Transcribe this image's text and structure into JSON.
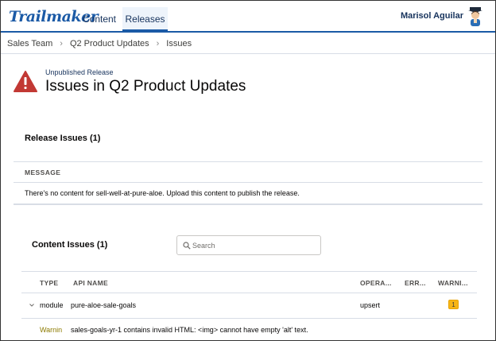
{
  "app": {
    "logo_text": "Trailmaker",
    "brand_color": "#1b5aa6"
  },
  "nav": {
    "tabs": [
      {
        "label": "Content",
        "active": false
      },
      {
        "label": "Releases",
        "active": true
      }
    ],
    "user_name": "Marisol Aguilar",
    "avatar_icon": "avatar-icon"
  },
  "breadcrumb": [
    "Sales Team",
    "Q2 Product Updates",
    "Issues"
  ],
  "header": {
    "eyebrow": "Unpublished Release",
    "title": "Issues in Q2 Product Updates",
    "icon": "warning-icon",
    "icon_color": "#c23934"
  },
  "release_issues": {
    "title": "Release Issues (1)",
    "column_header": "MESSAGE",
    "messages": [
      "There's no content for sell-well-at-pure-aloe. Upload this content to publish the release."
    ]
  },
  "content_issues": {
    "title": "Content Issues (1)",
    "search": {
      "placeholder": "Search",
      "value": ""
    },
    "columns": [
      "TYPE",
      "API NAME",
      "OPERA...",
      "ERR...",
      "WARNI..."
    ],
    "rows": [
      {
        "type": "module",
        "api_name": "pure-aloe-sale-goals",
        "operation": "upsert",
        "errors": "",
        "warnings": "1"
      }
    ],
    "detail": {
      "level": "Warnin",
      "message": "sales-goals-yr-1 contains invalid HTML: <img> cannot have empty 'alt' text."
    },
    "warning_badge_color": "#f7b515"
  }
}
